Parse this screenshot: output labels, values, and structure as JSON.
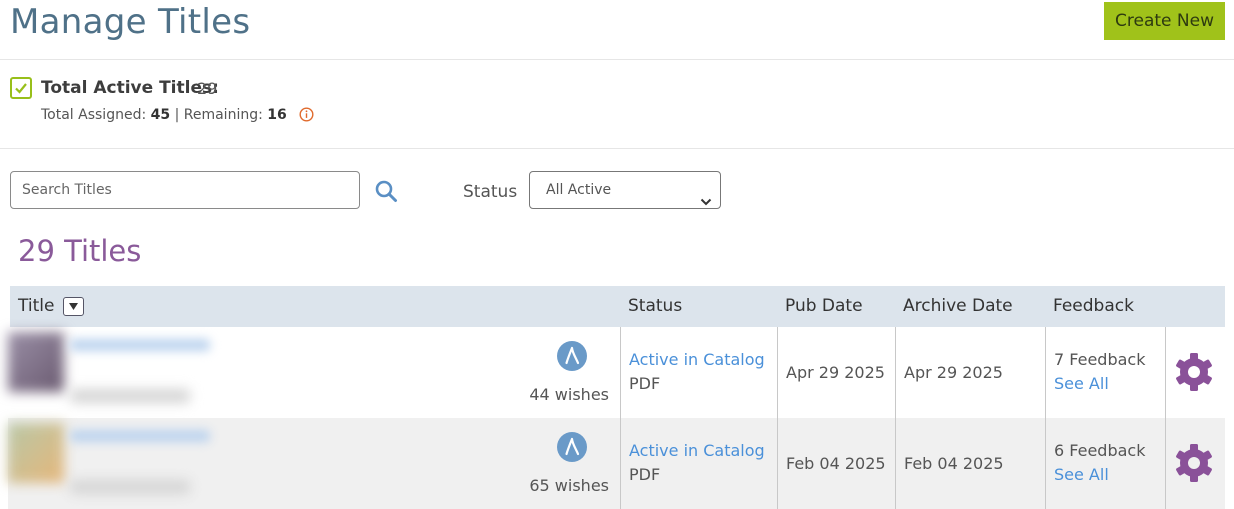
{
  "header": {
    "title": "Manage Titles",
    "create_label": "Create New"
  },
  "summary": {
    "total_label": "Total Active Titles:",
    "total_value": "29",
    "assigned_label": "Total Assigned:",
    "assigned_value": "45",
    "separator": "|",
    "remaining_label": "Remaining:",
    "remaining_value": "16"
  },
  "filters": {
    "search_placeholder": "Search Titles",
    "search_value": "",
    "status_label": "Status",
    "status_selected": "All Active"
  },
  "results": {
    "count_title": "29 Titles"
  },
  "table": {
    "columns": [
      "Title",
      "Status",
      "Pub Date",
      "Archive Date",
      "Feedback"
    ],
    "rows": [
      {
        "wishes": "44 wishes",
        "status": "Active in Catalog",
        "format": "PDF",
        "pub_date": "Apr 29 2025",
        "archive_date": "Apr 29 2025",
        "feedback": "7 Feedback",
        "see_all": "See All"
      },
      {
        "wishes": "65 wishes",
        "status": "Active in Catalog",
        "format": "PDF",
        "pub_date": "Feb 04 2025",
        "archive_date": "Feb 04 2025",
        "feedback": "6 Feedback",
        "see_all": "See All"
      }
    ]
  },
  "colors": {
    "accent_green": "#a0c21a",
    "title_blue": "#4f7188",
    "count_purple": "#8a5a9a",
    "link_blue": "#4a90d9",
    "gear_purple": "#8a5199",
    "wish_blue": "#6a9ac8"
  },
  "icons": [
    "check-icon",
    "info-icon",
    "search-icon",
    "chevron-down-icon",
    "sort-down-icon",
    "wishbone-icon",
    "gear-icon"
  ]
}
